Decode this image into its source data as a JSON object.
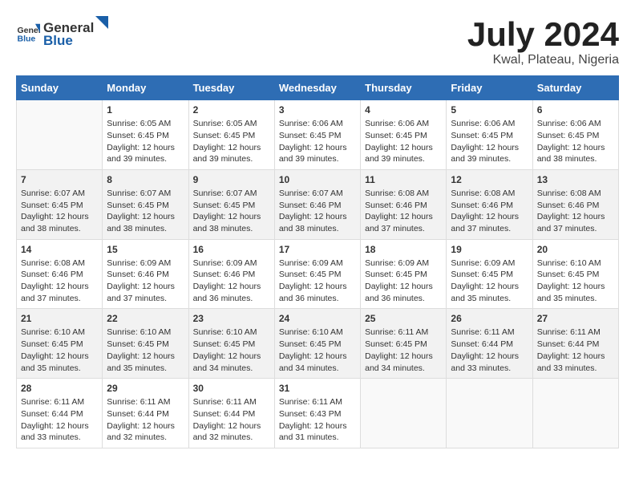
{
  "header": {
    "logo_general": "General",
    "logo_blue": "Blue",
    "month_year": "July 2024",
    "location": "Kwal, Plateau, Nigeria"
  },
  "weekdays": [
    "Sunday",
    "Monday",
    "Tuesday",
    "Wednesday",
    "Thursday",
    "Friday",
    "Saturday"
  ],
  "weeks": [
    [
      {
        "day": "",
        "sunrise": "",
        "sunset": "",
        "daylight": ""
      },
      {
        "day": "1",
        "sunrise": "Sunrise: 6:05 AM",
        "sunset": "Sunset: 6:45 PM",
        "daylight": "Daylight: 12 hours and 39 minutes."
      },
      {
        "day": "2",
        "sunrise": "Sunrise: 6:05 AM",
        "sunset": "Sunset: 6:45 PM",
        "daylight": "Daylight: 12 hours and 39 minutes."
      },
      {
        "day": "3",
        "sunrise": "Sunrise: 6:06 AM",
        "sunset": "Sunset: 6:45 PM",
        "daylight": "Daylight: 12 hours and 39 minutes."
      },
      {
        "day": "4",
        "sunrise": "Sunrise: 6:06 AM",
        "sunset": "Sunset: 6:45 PM",
        "daylight": "Daylight: 12 hours and 39 minutes."
      },
      {
        "day": "5",
        "sunrise": "Sunrise: 6:06 AM",
        "sunset": "Sunset: 6:45 PM",
        "daylight": "Daylight: 12 hours and 39 minutes."
      },
      {
        "day": "6",
        "sunrise": "Sunrise: 6:06 AM",
        "sunset": "Sunset: 6:45 PM",
        "daylight": "Daylight: 12 hours and 38 minutes."
      }
    ],
    [
      {
        "day": "7",
        "sunrise": "Sunrise: 6:07 AM",
        "sunset": "Sunset: 6:45 PM",
        "daylight": "Daylight: 12 hours and 38 minutes."
      },
      {
        "day": "8",
        "sunrise": "Sunrise: 6:07 AM",
        "sunset": "Sunset: 6:45 PM",
        "daylight": "Daylight: 12 hours and 38 minutes."
      },
      {
        "day": "9",
        "sunrise": "Sunrise: 6:07 AM",
        "sunset": "Sunset: 6:45 PM",
        "daylight": "Daylight: 12 hours and 38 minutes."
      },
      {
        "day": "10",
        "sunrise": "Sunrise: 6:07 AM",
        "sunset": "Sunset: 6:46 PM",
        "daylight": "Daylight: 12 hours and 38 minutes."
      },
      {
        "day": "11",
        "sunrise": "Sunrise: 6:08 AM",
        "sunset": "Sunset: 6:46 PM",
        "daylight": "Daylight: 12 hours and 37 minutes."
      },
      {
        "day": "12",
        "sunrise": "Sunrise: 6:08 AM",
        "sunset": "Sunset: 6:46 PM",
        "daylight": "Daylight: 12 hours and 37 minutes."
      },
      {
        "day": "13",
        "sunrise": "Sunrise: 6:08 AM",
        "sunset": "Sunset: 6:46 PM",
        "daylight": "Daylight: 12 hours and 37 minutes."
      }
    ],
    [
      {
        "day": "14",
        "sunrise": "Sunrise: 6:08 AM",
        "sunset": "Sunset: 6:46 PM",
        "daylight": "Daylight: 12 hours and 37 minutes."
      },
      {
        "day": "15",
        "sunrise": "Sunrise: 6:09 AM",
        "sunset": "Sunset: 6:46 PM",
        "daylight": "Daylight: 12 hours and 37 minutes."
      },
      {
        "day": "16",
        "sunrise": "Sunrise: 6:09 AM",
        "sunset": "Sunset: 6:46 PM",
        "daylight": "Daylight: 12 hours and 36 minutes."
      },
      {
        "day": "17",
        "sunrise": "Sunrise: 6:09 AM",
        "sunset": "Sunset: 6:45 PM",
        "daylight": "Daylight: 12 hours and 36 minutes."
      },
      {
        "day": "18",
        "sunrise": "Sunrise: 6:09 AM",
        "sunset": "Sunset: 6:45 PM",
        "daylight": "Daylight: 12 hours and 36 minutes."
      },
      {
        "day": "19",
        "sunrise": "Sunrise: 6:09 AM",
        "sunset": "Sunset: 6:45 PM",
        "daylight": "Daylight: 12 hours and 35 minutes."
      },
      {
        "day": "20",
        "sunrise": "Sunrise: 6:10 AM",
        "sunset": "Sunset: 6:45 PM",
        "daylight": "Daylight: 12 hours and 35 minutes."
      }
    ],
    [
      {
        "day": "21",
        "sunrise": "Sunrise: 6:10 AM",
        "sunset": "Sunset: 6:45 PM",
        "daylight": "Daylight: 12 hours and 35 minutes."
      },
      {
        "day": "22",
        "sunrise": "Sunrise: 6:10 AM",
        "sunset": "Sunset: 6:45 PM",
        "daylight": "Daylight: 12 hours and 35 minutes."
      },
      {
        "day": "23",
        "sunrise": "Sunrise: 6:10 AM",
        "sunset": "Sunset: 6:45 PM",
        "daylight": "Daylight: 12 hours and 34 minutes."
      },
      {
        "day": "24",
        "sunrise": "Sunrise: 6:10 AM",
        "sunset": "Sunset: 6:45 PM",
        "daylight": "Daylight: 12 hours and 34 minutes."
      },
      {
        "day": "25",
        "sunrise": "Sunrise: 6:11 AM",
        "sunset": "Sunset: 6:45 PM",
        "daylight": "Daylight: 12 hours and 34 minutes."
      },
      {
        "day": "26",
        "sunrise": "Sunrise: 6:11 AM",
        "sunset": "Sunset: 6:44 PM",
        "daylight": "Daylight: 12 hours and 33 minutes."
      },
      {
        "day": "27",
        "sunrise": "Sunrise: 6:11 AM",
        "sunset": "Sunset: 6:44 PM",
        "daylight": "Daylight: 12 hours and 33 minutes."
      }
    ],
    [
      {
        "day": "28",
        "sunrise": "Sunrise: 6:11 AM",
        "sunset": "Sunset: 6:44 PM",
        "daylight": "Daylight: 12 hours and 33 minutes."
      },
      {
        "day": "29",
        "sunrise": "Sunrise: 6:11 AM",
        "sunset": "Sunset: 6:44 PM",
        "daylight": "Daylight: 12 hours and 32 minutes."
      },
      {
        "day": "30",
        "sunrise": "Sunrise: 6:11 AM",
        "sunset": "Sunset: 6:44 PM",
        "daylight": "Daylight: 12 hours and 32 minutes."
      },
      {
        "day": "31",
        "sunrise": "Sunrise: 6:11 AM",
        "sunset": "Sunset: 6:43 PM",
        "daylight": "Daylight: 12 hours and 31 minutes."
      },
      {
        "day": "",
        "sunrise": "",
        "sunset": "",
        "daylight": ""
      },
      {
        "day": "",
        "sunrise": "",
        "sunset": "",
        "daylight": ""
      },
      {
        "day": "",
        "sunrise": "",
        "sunset": "",
        "daylight": ""
      }
    ]
  ]
}
